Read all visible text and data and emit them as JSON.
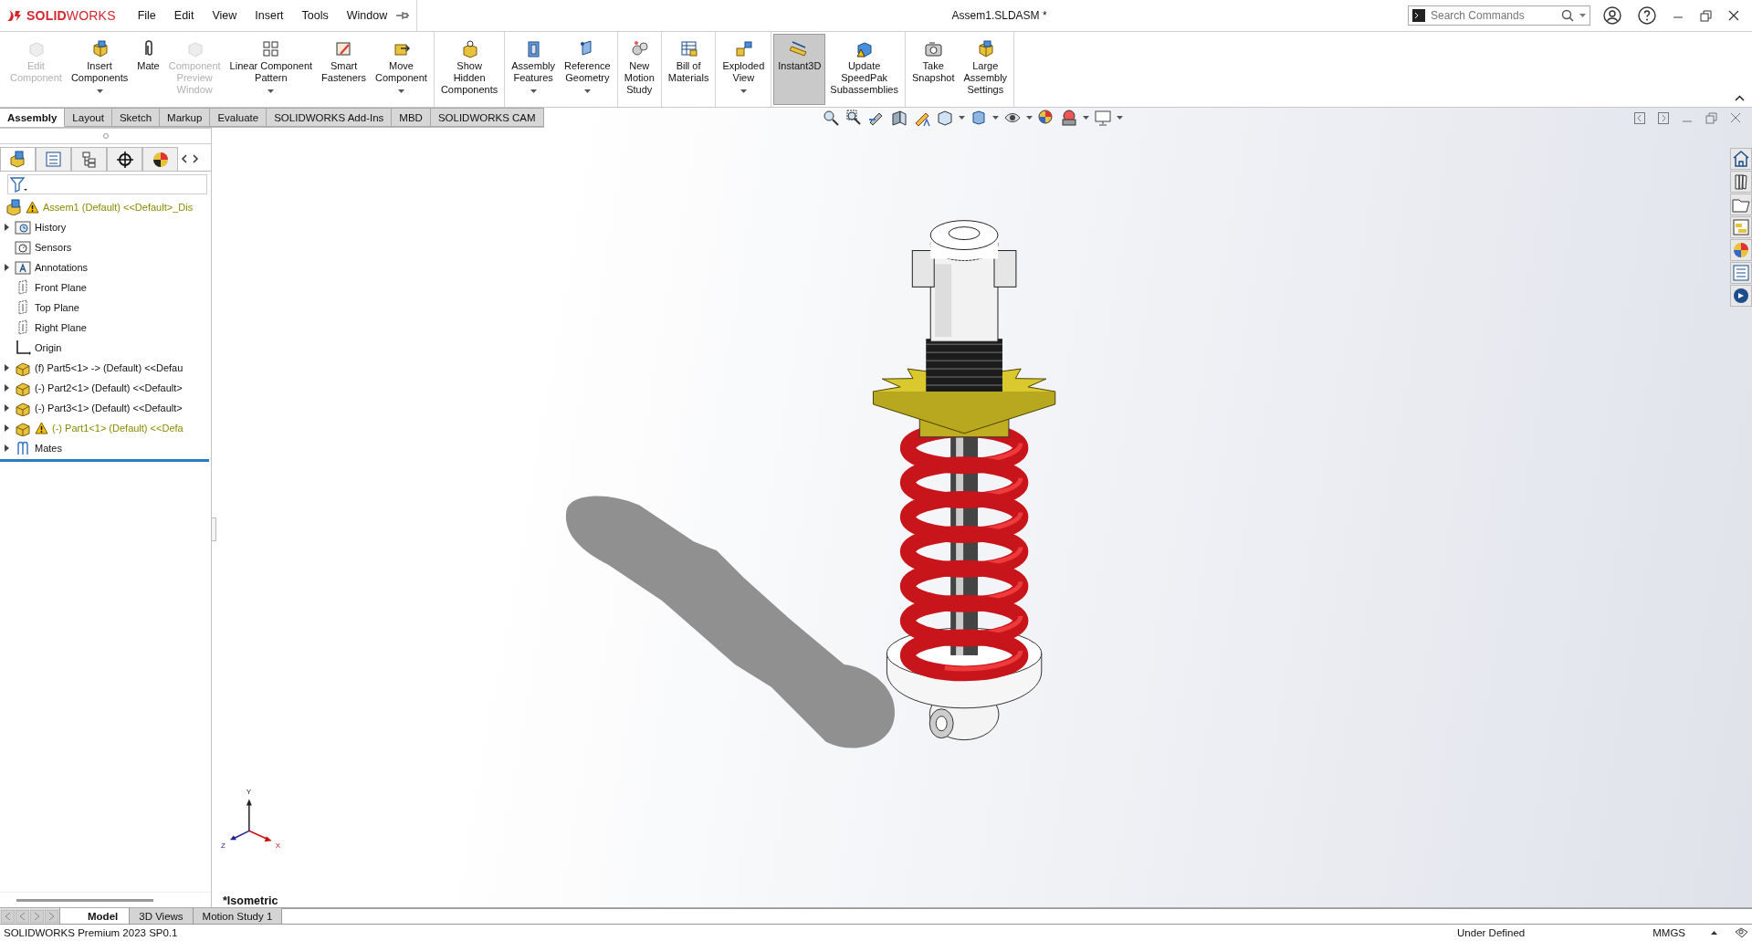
{
  "window": {
    "title": "Assem1.SLDASM *",
    "logo": "**SOLID**WORKS"
  },
  "menu": [
    "File",
    "Edit",
    "View",
    "Insert",
    "Tools",
    "Window"
  ],
  "search": {
    "placeholder": "Search Commands"
  },
  "ribbon": {
    "groups": [
      [
        {
          "label": "Edit\nComponent",
          "disabled": true,
          "selected": false,
          "dropdown": false
        },
        {
          "label": "Insert\nComponents",
          "disabled": false,
          "selected": false,
          "dropdown": true
        },
        {
          "label": "Mate",
          "disabled": false,
          "selected": false,
          "dropdown": false
        },
        {
          "label": "Component\nPreview\nWindow",
          "disabled": true,
          "selected": false,
          "dropdown": false
        },
        {
          "label": "Linear Component\nPattern",
          "disabled": false,
          "selected": false,
          "dropdown": true
        },
        {
          "label": "Smart\nFasteners",
          "disabled": false,
          "selected": false,
          "dropdown": false
        },
        {
          "label": "Move\nComponent",
          "disabled": false,
          "selected": false,
          "dropdown": true
        }
      ],
      [
        {
          "label": "Show\nHidden\nComponents",
          "disabled": false,
          "selected": false,
          "dropdown": false
        }
      ],
      [
        {
          "label": "Assembly\nFeatures",
          "disabled": false,
          "selected": false,
          "dropdown": true
        },
        {
          "label": "Reference\nGeometry",
          "disabled": false,
          "selected": false,
          "dropdown": true
        }
      ],
      [
        {
          "label": "New\nMotion\nStudy",
          "disabled": false,
          "selected": false,
          "dropdown": false
        }
      ],
      [
        {
          "label": "Bill of\nMaterials",
          "disabled": false,
          "selected": false,
          "dropdown": false
        }
      ],
      [
        {
          "label": "Exploded\nView",
          "disabled": false,
          "selected": false,
          "dropdown": true
        }
      ],
      [
        {
          "label": "Instant3D",
          "disabled": false,
          "selected": true,
          "dropdown": false
        },
        {
          "label": "Update\nSpeedPak\nSubassemblies",
          "disabled": false,
          "selected": false,
          "dropdown": false
        }
      ],
      [
        {
          "label": "Take\nSnapshot",
          "disabled": false,
          "selected": false,
          "dropdown": false
        },
        {
          "label": "Large\nAssembly\nSettings",
          "disabled": false,
          "selected": false,
          "dropdown": false
        }
      ]
    ]
  },
  "command_tabs": [
    {
      "label": "Assembly",
      "selected": true
    },
    {
      "label": "Layout",
      "selected": false
    },
    {
      "label": "Sketch",
      "selected": false
    },
    {
      "label": "Markup",
      "selected": false
    },
    {
      "label": "Evaluate",
      "selected": false
    },
    {
      "label": "SOLIDWORKS Add-Ins",
      "selected": false
    },
    {
      "label": "MBD",
      "selected": false
    },
    {
      "label": "SOLIDWORKS CAM",
      "selected": false
    }
  ],
  "panel_tabs": [
    {
      "selected": true
    },
    {
      "selected": false
    },
    {
      "selected": false
    },
    {
      "selected": false
    },
    {
      "selected": false
    }
  ],
  "tree": {
    "label": "Assem1 (Default) <<Default>_Dis",
    "kind": "assembly",
    "warning": true,
    "expander": false,
    "children": [
      {
        "label": "History",
        "kind": "history",
        "warning": false,
        "expander": true
      },
      {
        "label": "Sensors",
        "kind": "sensors",
        "warning": false,
        "expander": false
      },
      {
        "label": "Annotations",
        "kind": "annotations",
        "warning": false,
        "expander": true
      },
      {
        "label": "Front Plane",
        "kind": "plane",
        "warning": false,
        "expander": false
      },
      {
        "label": "Top Plane",
        "kind": "plane",
        "warning": false,
        "expander": false
      },
      {
        "label": "Right Plane",
        "kind": "plane",
        "warning": false,
        "expander": false
      },
      {
        "label": "Origin",
        "kind": "origin",
        "warning": false,
        "expander": false
      },
      {
        "label": "(f) Part5<1> -> (Default) <<Defau",
        "kind": "part",
        "warning": false,
        "expander": true
      },
      {
        "label": "(-) Part2<1> (Default) <<Default>",
        "kind": "part",
        "warning": false,
        "expander": true
      },
      {
        "label": "(-) Part3<1> (Default) <<Default>",
        "kind": "part",
        "warning": false,
        "expander": true
      },
      {
        "label": "(-) Part1<1> (Default) <<Defa",
        "kind": "part",
        "warning": true,
        "expander": true
      },
      {
        "label": "Mates",
        "kind": "mates",
        "warning": false,
        "expander": true
      }
    ]
  },
  "viewport": {
    "view_name": "*Isometric",
    "triad": {
      "x": "X",
      "y": "Y",
      "z": "Z"
    }
  },
  "bottom_tabs": [
    {
      "label": "Model",
      "selected": true
    },
    {
      "label": "3D Views",
      "selected": false
    },
    {
      "label": "Motion Study 1",
      "selected": false
    }
  ],
  "status_bar": {
    "product": "SOLIDWORKS Premium 2023 SP0.1",
    "state": "Under Defined",
    "units": "MMGS"
  }
}
